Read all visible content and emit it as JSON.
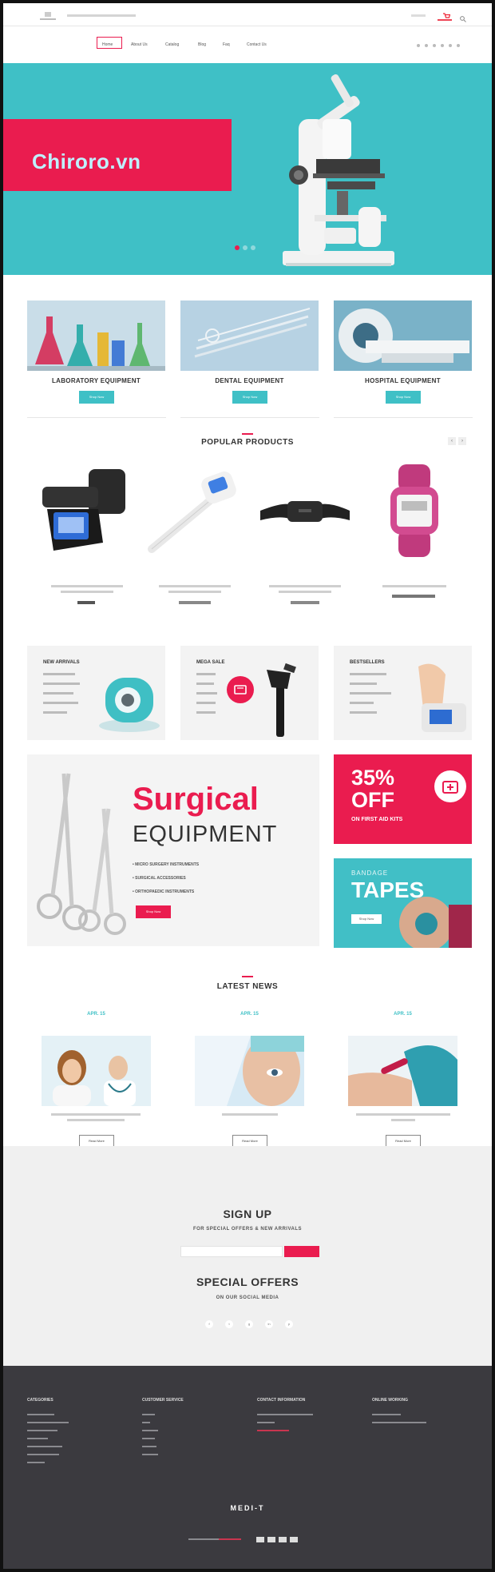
{
  "header": {
    "logo_caption": "",
    "contact_text": "",
    "login_text": "",
    "cart_label": ""
  },
  "nav": {
    "items": [
      "Home",
      "About Us",
      "Catalog",
      "Blog",
      "Faq",
      "Contact Us"
    ]
  },
  "hero": {
    "title": "Chiroro.vn",
    "slides": 3,
    "active_slide": 1,
    "colors": {
      "background": "#3fc0c6",
      "banner": "#ea1c4f",
      "title": "#bff1ff"
    }
  },
  "categories": [
    {
      "title": "LABORATORY EQUIPMENT",
      "button": "Shop Now"
    },
    {
      "title": "DENTAL EQUIPMENT",
      "button": "Shop Now"
    },
    {
      "title": "HOSPITAL EQUIPMENT",
      "button": "Shop Now"
    }
  ],
  "popular": {
    "title": "POPULAR PRODUCTS",
    "products": [
      {
        "icon": "blood-pressure-monitor-icon",
        "name": "",
        "price": ""
      },
      {
        "icon": "digital-thermometer-icon",
        "name": "",
        "price": ""
      },
      {
        "icon": "heart-rate-strap-icon",
        "name": "",
        "price": ""
      },
      {
        "icon": "fitness-watch-icon",
        "name": "",
        "price": ""
      }
    ]
  },
  "promos": [
    {
      "title": "NEW ARRIVALS",
      "items": [
        "",
        "",
        "",
        "",
        ""
      ]
    },
    {
      "title": "MEGA SALE",
      "items": [
        "",
        "",
        "",
        "",
        ""
      ]
    },
    {
      "title": "BESTSELLERS",
      "items": [
        "",
        "",
        "",
        "",
        ""
      ]
    }
  ],
  "surgical": {
    "title_line1": "Surgical",
    "title_line2": "EQUIPMENT",
    "bullets": [
      "MICRO SURGERY INSTRUMENTS",
      "SURGICAL ACCESSORIES",
      "ORTHOPAEDIC INSTRUMENTS"
    ],
    "button": "Shop Now"
  },
  "offer": {
    "headline_1": "35%",
    "headline_2": "OFF",
    "subline": "ON FIRST AID KITS"
  },
  "tapes": {
    "small": "BANDAGE",
    "big": "TAPES",
    "button": "Shop Now"
  },
  "news": {
    "title": "LATEST NEWS",
    "items": [
      {
        "date": "APR. 15",
        "caption": "",
        "button": "Read More"
      },
      {
        "date": "APR. 15",
        "caption": "",
        "button": "Read More"
      },
      {
        "date": "APR. 15",
        "caption": "",
        "button": "Read More"
      }
    ]
  },
  "signup": {
    "title": "SIGN UP",
    "subtitle": "FOR SPECIAL OFFERS & NEW ARRIVALS",
    "email_placeholder": "",
    "button": "",
    "offers_title": "SPECIAL OFFERS",
    "offers_subtitle": "ON OUR SOCIAL MEDIA",
    "socials": [
      "f",
      "t",
      "g",
      "in",
      "p"
    ]
  },
  "footer": {
    "columns": [
      {
        "title": "CATEGORIES",
        "links": [
          "",
          "",
          "",
          "",
          "",
          "",
          ""
        ]
      },
      {
        "title": "CUSTOMER SERVICE",
        "links": [
          "",
          "",
          "",
          "",
          "",
          ""
        ]
      },
      {
        "title": "CONTACT INFORMATION",
        "links": [
          "",
          "",
          ""
        ]
      },
      {
        "title": "ONLINE WORKING",
        "links": [
          "",
          ""
        ]
      }
    ],
    "logo": "MEDI-T",
    "copyright": ""
  }
}
